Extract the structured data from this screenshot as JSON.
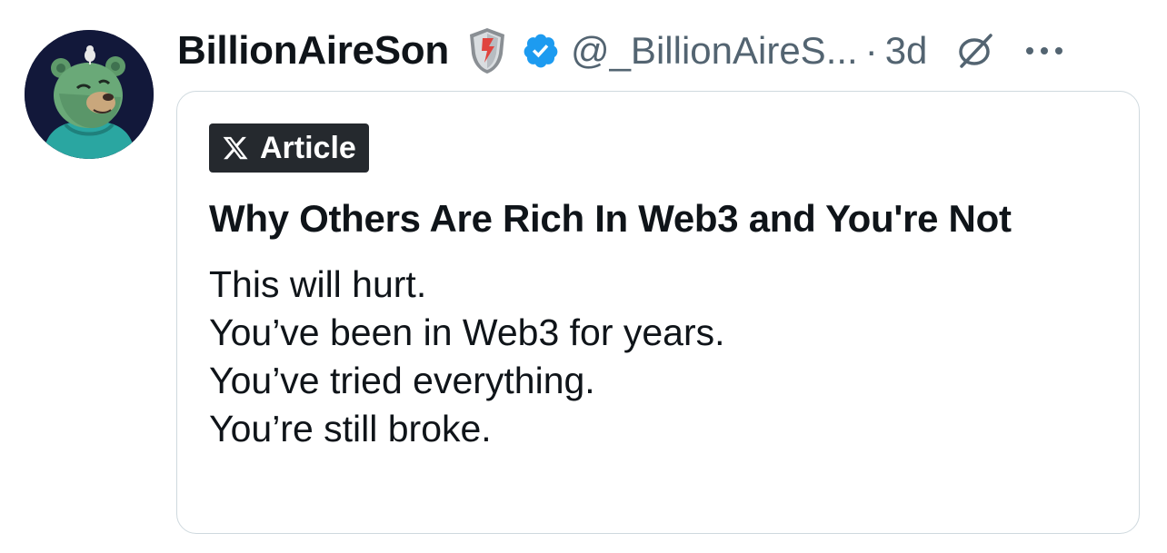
{
  "tweet": {
    "author": {
      "display_name": "BillionAireSon",
      "handle": "@_BillionAireS...",
      "avatar_icon": "bear-avatar-icon",
      "affiliation_badge_icon": "shield-badge-icon",
      "verified_icon": "verified-badge-icon"
    },
    "separator": "·",
    "time": "3d",
    "grok_icon": "grok-icon",
    "more_icon": "more-horizontal-icon",
    "colors": {
      "text_primary": "#0f1419",
      "text_secondary": "#536471",
      "verified_blue": "#1d9bf0",
      "card_border": "#cfd9de",
      "article_badge_bg": "#25292e"
    }
  },
  "article": {
    "badge_label": "Article",
    "badge_icon": "x-logo-icon",
    "title": "Why Others Are Rich In Web3 and You're Not",
    "lines": [
      "This will hurt.",
      "You’ve been in Web3 for years.",
      "You’ve tried everything.",
      "You’re still broke."
    ]
  }
}
